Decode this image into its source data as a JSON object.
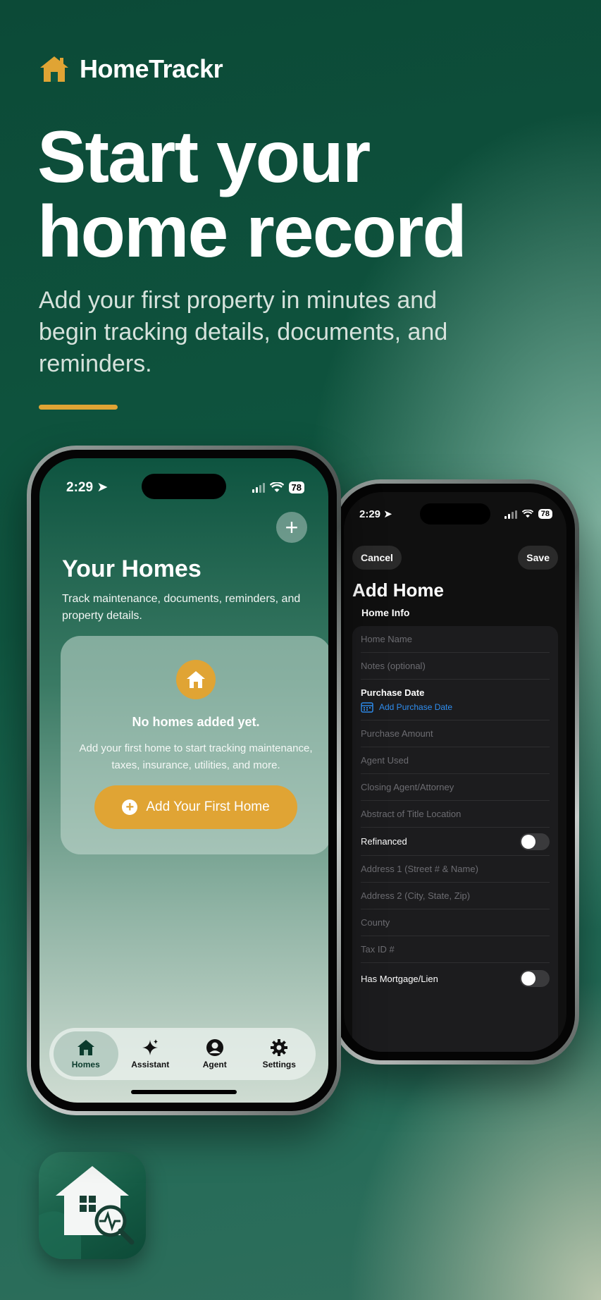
{
  "brand": {
    "name": "HomeTrackr",
    "logo_icon": "house-icon",
    "accent": "#e0a434"
  },
  "hero": {
    "headline_line1": "Start your",
    "headline_line2": "home record",
    "subhead": "Add your first property in minutes and begin tracking details, documents, and reminders."
  },
  "phone_left": {
    "status": {
      "time": "2:29",
      "battery": "78"
    },
    "title": "Your Homes",
    "description": "Track maintenance, documents, reminders, and property details.",
    "empty": {
      "title": "No homes added yet.",
      "description": "Add your first home to start tracking maintenance, taxes, insurance, utilities, and more.",
      "button": "Add Your First Home"
    },
    "tabs": [
      {
        "label": "Homes",
        "icon": "house-icon",
        "active": true
      },
      {
        "label": "Assistant",
        "icon": "sparkle-icon",
        "active": false
      },
      {
        "label": "Agent",
        "icon": "person-icon",
        "active": false
      },
      {
        "label": "Settings",
        "icon": "gear-icon",
        "active": false
      }
    ]
  },
  "phone_right": {
    "status": {
      "time": "2:29",
      "battery": "78"
    },
    "cancel": "Cancel",
    "save": "Save",
    "title": "Add Home",
    "section": "Home Info",
    "fields": {
      "home_name": "Home Name",
      "notes": "Notes (optional)",
      "purchase_date_label": "Purchase Date",
      "purchase_date_link": "Add Purchase Date",
      "purchase_amount": "Purchase Amount",
      "agent_used": "Agent Used",
      "closing_agent": "Closing Agent/Attorney",
      "abstract_title": "Abstract of Title Location",
      "refinanced": "Refinanced",
      "address1": "Address 1 (Street # & Name)",
      "address2": "Address 2 (City, State, Zip)",
      "county": "County",
      "tax_id": "Tax ID #",
      "has_mortgage": "Has Mortgage/Lien"
    }
  }
}
